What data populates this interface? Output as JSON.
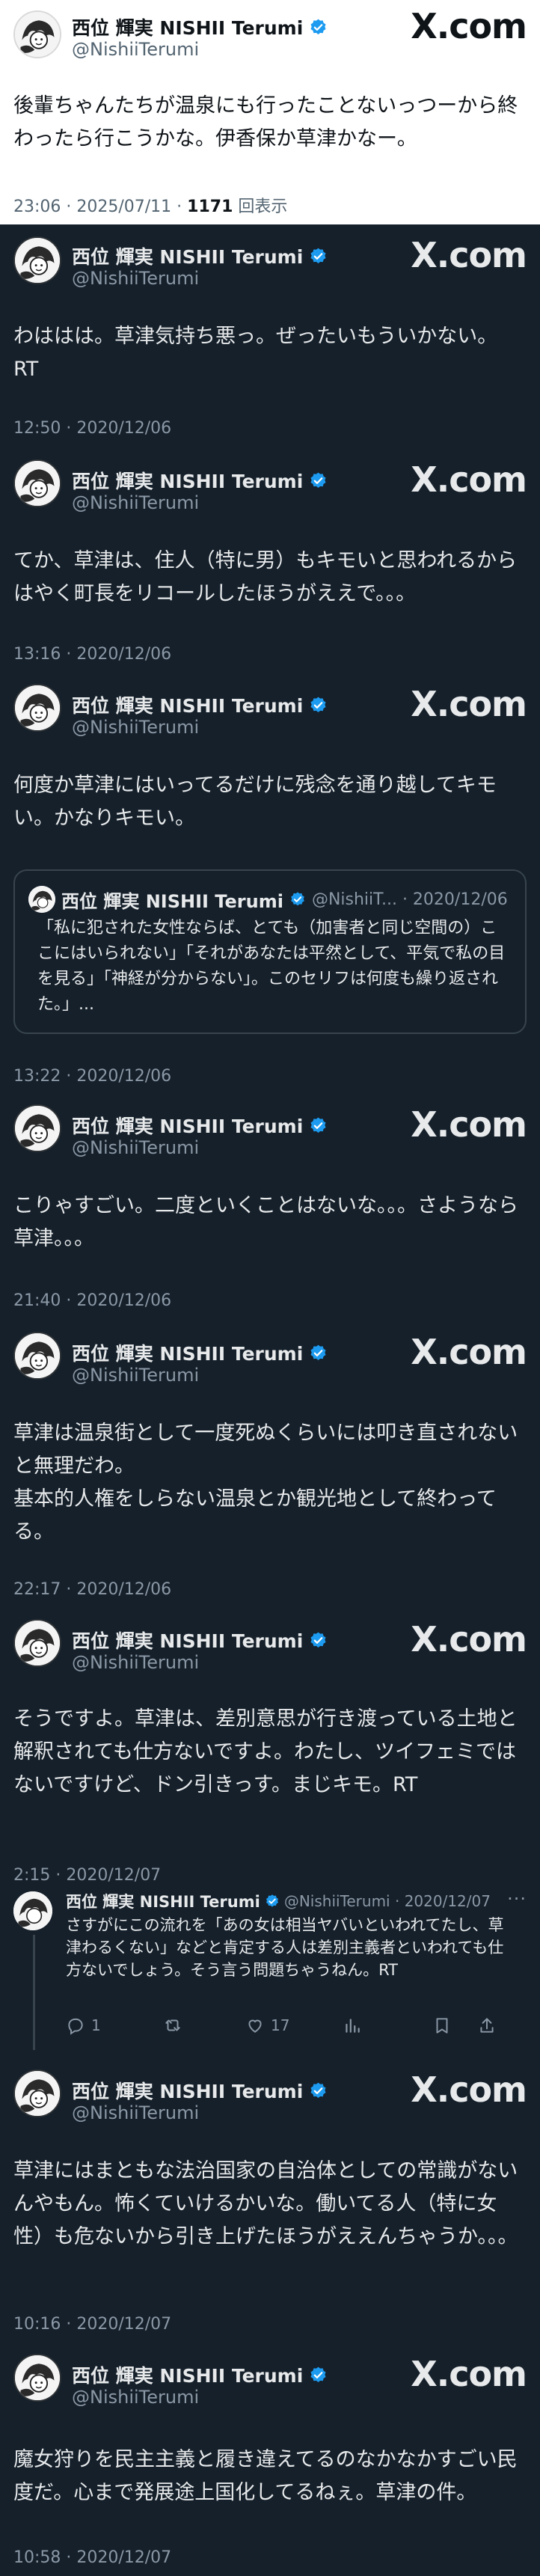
{
  "profile": {
    "name": "西位 輝実 NISHII Terumi",
    "handle": "@NishiiTerumi",
    "logo_text": "X.com"
  },
  "top_post": {
    "text": "後輩ちゃんたちが温泉にも行ったことないっつーから終わったら行こうかな。伊香保か草津かなー。",
    "time_date": "23:06 · 2025/07/11 · ",
    "views_count": "1171",
    "views_label": " 回表示"
  },
  "posts": [
    {
      "text": "わははは。草津気持ち悪っ。ぜったいもういかない。\nRT",
      "timestamp": "12:50 · 2020/12/06"
    },
    {
      "text": "てか、草津は、住人（特に男）もキモいと思われるからはやく町長をリコールしたほうがええで。。。",
      "timestamp": "13:16 · 2020/12/06"
    },
    {
      "text": "何度か草津にはいってるだけに残念を通り越してキモい。かなりキモい。",
      "quote": {
        "name": "西位 輝実 NISHII Terumi",
        "meta": "@NishiiT... · 2020/12/06",
        "text": "「私に犯された女性ならば、とても（加害者と同じ空間の）ここにはいられない」「それがあなたは平然として、平気で私の目を見る」「神経が分からない」。このセリフは何度も繰り返された。」..."
      },
      "timestamp": "13:22 · 2020/12/06"
    },
    {
      "text": "こりゃすごい。二度といくことはないな。。。さようなら草津。。。",
      "timestamp": "21:40 · 2020/12/06"
    },
    {
      "text": "草津は温泉街として一度死ぬくらいには叩き直されないと無理だわ。\n基本的人権をしらない温泉とか観光地として終わってる。",
      "timestamp": "22:17 · 2020/12/06"
    },
    {
      "text": "そうですよ。草津は、差別意思が行き渡っている土地と解釈されても仕方ないですよ。わたし、ツイフェミではないですけど、ドン引きっす。まじキモ。RT",
      "timestamp": "2:15 · 2020/12/07",
      "reply": {
        "name": "西位 輝実 NISHII Terumi",
        "meta": "@NishiiTerumi · 2020/12/07",
        "text": "さすがにこの流れを「あの女は相当ヤバいといわれてたし、草津わるくない」などと肯定する人は差別主義者といわれても仕方ないでしょう。そう言う問題ちゃうねん。RT",
        "reply_count": "1",
        "like_count": "17",
        "more": "···"
      }
    },
    {
      "text": "草津にはまともな法治国家の自治体としての常識がないんやもん。怖くていけるかいな。働いてる人（特に女性）も危ないから引き上げたほうがええんちゃうか。。。",
      "timestamp": "10:16 · 2020/12/07"
    },
    {
      "text": "魔女狩りを民主主義と履き違えてるのなかなかすごい民度だ。心まで発展途上国化してるねぇ。草津の件。",
      "timestamp": "10:58 · 2020/12/07"
    }
  ],
  "colors": {
    "dark_bg": "#15202b",
    "verified_blue": "#1d9bf0",
    "muted_text": "#8b98a5"
  }
}
